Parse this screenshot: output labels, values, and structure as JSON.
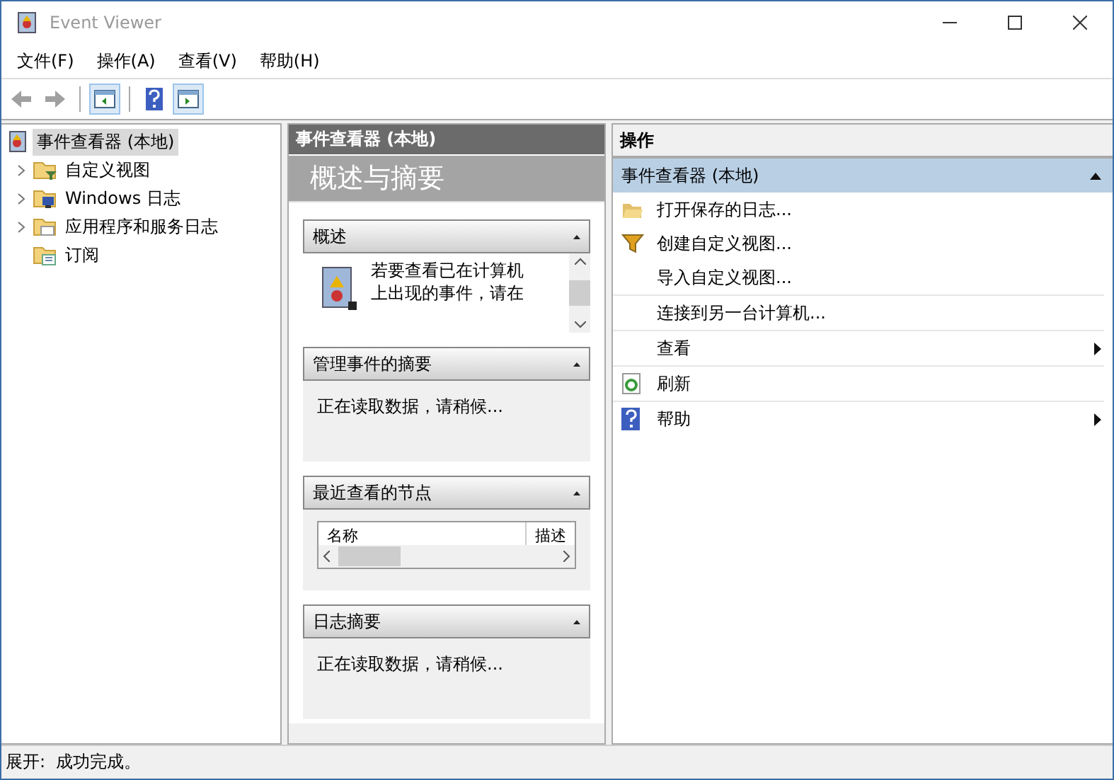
{
  "window": {
    "title": "Event Viewer"
  },
  "menu": [
    "文件(F)",
    "操作(A)",
    "查看(V)",
    "帮助(H)"
  ],
  "toolbar": [
    {
      "kind": "back",
      "disabled": true
    },
    {
      "kind": "forward",
      "disabled": true
    },
    {
      "kind": "tree-toggle",
      "on": true
    },
    {
      "kind": "help",
      "on": false
    },
    {
      "kind": "action-toggle",
      "on": true
    }
  ],
  "tree": [
    {
      "label": "事件查看器 (本地)",
      "selected": true,
      "children": [
        {
          "label": "自定义视图",
          "expandable": true,
          "selected": false
        },
        {
          "label": "Windows 日志",
          "expandable": true,
          "selected": false
        },
        {
          "label": "应用程序和服务日志",
          "expandable": true,
          "selected": false
        },
        {
          "label": "订阅",
          "expandable": false,
          "selected": false
        }
      ]
    }
  ],
  "center": {
    "header": "事件查看器 (本地)",
    "title": "概述与摘要",
    "sections": [
      {
        "kind": "overview",
        "title": "概述",
        "expanded": true,
        "text": "若要查看已在计算机上出现的事件，请在"
      },
      {
        "kind": "status",
        "title": "管理事件的摘要",
        "expanded": true,
        "text": "正在读取数据，请稍候..."
      },
      {
        "kind": "table",
        "title": "最近查看的节点",
        "expanded": true,
        "columns": [
          "名称",
          "描述"
        ]
      },
      {
        "kind": "status",
        "title": "日志摘要",
        "expanded": true,
        "text": "正在读取数据，请稍候..."
      }
    ]
  },
  "actions": {
    "header": "操作",
    "group": {
      "label": "事件查看器 (本地)",
      "expanded": true
    },
    "groups": [
      [
        {
          "label": "打开保存的日志...",
          "submenu": false
        },
        {
          "label": "创建自定义视图...",
          "submenu": false
        },
        {
          "label": "导入自定义视图...",
          "submenu": false
        }
      ],
      [
        {
          "label": "连接到另一台计算机...",
          "submenu": false
        }
      ],
      [
        {
          "label": "查看",
          "submenu": true
        }
      ],
      [
        {
          "label": "刷新",
          "submenu": false
        }
      ],
      [
        {
          "label": "帮助",
          "submenu": true
        }
      ]
    ]
  },
  "status_bar": "展开:  成功完成。"
}
